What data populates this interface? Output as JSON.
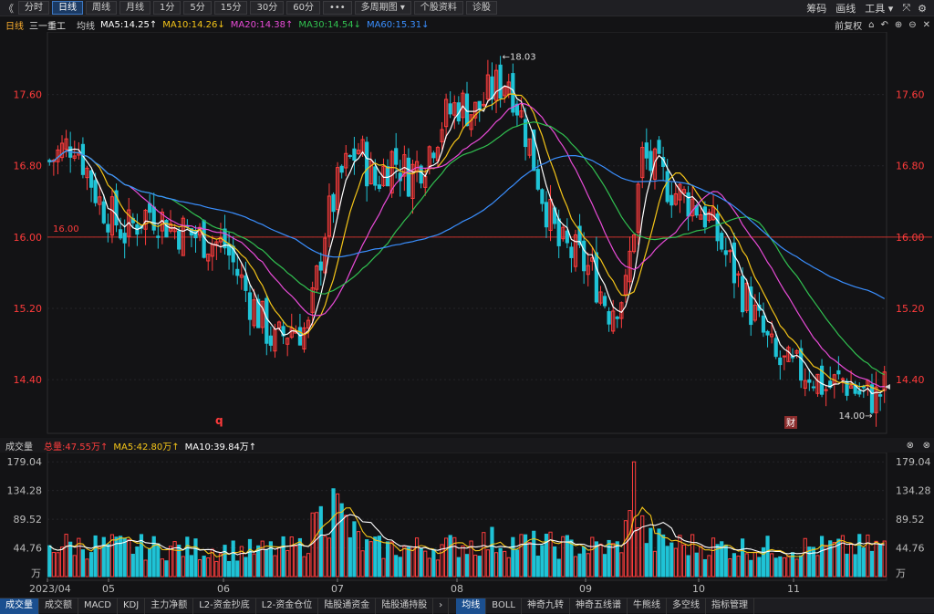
{
  "toolbar": {
    "back": "《",
    "buttons": [
      "分时",
      "日线",
      "周线",
      "月线",
      "1分",
      "5分",
      "15分",
      "30分",
      "60分",
      "•••",
      "多周期图 ▾",
      "个股资料",
      "诊股"
    ],
    "active_index": 1,
    "right_links": [
      "筹码",
      "画线",
      "工具 ▾"
    ],
    "icons": [
      "⤧",
      "⚙"
    ]
  },
  "ma_header": {
    "period": "日线",
    "stock": "三一重工",
    "avg_label": "均线",
    "ma5": "MA5:14.25↑",
    "ma10": "MA10:14.26↓",
    "ma20": "MA20:14.38↑",
    "ma30": "MA30:14.54↓",
    "ma60": "MA60:15.31↓",
    "right_label": "前复权",
    "right_icons": [
      "⌂",
      "↶",
      "⊕",
      "⊖",
      "✕"
    ]
  },
  "colors": {
    "up": "#ff3d3d",
    "down": "#1fc3d6",
    "ma5": "#ffffff",
    "ma10": "#f5c518",
    "ma20": "#e94bd8",
    "ma30": "#31c050",
    "ma60": "#3a8fff",
    "axis_red": "#ff3b3b",
    "vol_label": "#bbbbbb"
  },
  "volume_header": {
    "title": "成交量",
    "total": "总量:47.55万↑",
    "ma5": "MA5:42.80万↑",
    "ma10": "MA10:39.84万↑",
    "icons": [
      "⊗",
      "⊗"
    ]
  },
  "price_axis": {
    "ticks": [
      "17.60",
      "16.80",
      "16.00",
      "15.20",
      "14.40"
    ]
  },
  "volume_axis": {
    "ticks": [
      "179.04",
      "134.28",
      "89.52",
      "44.76"
    ],
    "unit": "万"
  },
  "x_axis": {
    "labels": [
      "2023/04",
      "05",
      "06",
      "07",
      "08",
      "09",
      "10",
      "11"
    ]
  },
  "annotations": {
    "high": "←18.03",
    "low": "14.00→",
    "hline": "16.00",
    "marker_q": "q",
    "marker_cai": "财"
  },
  "bottom_tabs": {
    "left": [
      "成交量",
      "成交额",
      "MACD",
      "KDJ",
      "主力净额",
      "L2-资金抄底",
      "L2-资金仓位",
      "陆股通资金",
      "陆股通持股"
    ],
    "left_active": 0,
    "arrow": "›",
    "right": [
      "均线",
      "BOLL",
      "神奇九转",
      "神奇五线谱",
      "牛熊线",
      "多空线",
      "指标管理"
    ],
    "right_active": 0
  },
  "chart_data": {
    "type": "candlestick",
    "y_range": [
      13.9,
      18.2
    ],
    "hline_value": 16.0,
    "ohlc_knots": [
      [
        0,
        16.85
      ],
      [
        6,
        17.1
      ],
      [
        12,
        16.4
      ],
      [
        18,
        16.05
      ],
      [
        24,
        16.3
      ],
      [
        30,
        16.1
      ],
      [
        36,
        16.0
      ],
      [
        42,
        15.9
      ],
      [
        48,
        15.3
      ],
      [
        54,
        14.8
      ],
      [
        58,
        15.0
      ],
      [
        62,
        14.95
      ],
      [
        66,
        16.1
      ],
      [
        70,
        16.7
      ],
      [
        74,
        17.0
      ],
      [
        78,
        16.6
      ],
      [
        82,
        16.9
      ],
      [
        86,
        16.7
      ],
      [
        90,
        16.9
      ],
      [
        94,
        17.3
      ],
      [
        98,
        17.5
      ],
      [
        102,
        17.4
      ],
      [
        106,
        17.65
      ],
      [
        110,
        17.8
      ],
      [
        114,
        17.2
      ],
      [
        118,
        16.5
      ],
      [
        122,
        15.9
      ],
      [
        126,
        15.8
      ],
      [
        130,
        15.6
      ],
      [
        134,
        15.2
      ],
      [
        138,
        15.4
      ],
      [
        142,
        16.9
      ],
      [
        146,
        16.7
      ],
      [
        150,
        16.5
      ],
      [
        154,
        16.4
      ],
      [
        158,
        16.2
      ],
      [
        162,
        15.8
      ],
      [
        166,
        15.4
      ],
      [
        170,
        15.0
      ],
      [
        174,
        14.6
      ],
      [
        178,
        14.5
      ],
      [
        182,
        14.5
      ],
      [
        186,
        14.3
      ],
      [
        190,
        14.4
      ],
      [
        194,
        14.25
      ],
      [
        198,
        14.2
      ],
      [
        200,
        14.3
      ]
    ],
    "volume_knots": [
      [
        0,
        50
      ],
      [
        10,
        48
      ],
      [
        20,
        46
      ],
      [
        30,
        44
      ],
      [
        40,
        42
      ],
      [
        50,
        40
      ],
      [
        60,
        45
      ],
      [
        64,
        80
      ],
      [
        68,
        115
      ],
      [
        72,
        70
      ],
      [
        76,
        45
      ],
      [
        86,
        44
      ],
      [
        96,
        47
      ],
      [
        106,
        55
      ],
      [
        116,
        50
      ],
      [
        126,
        46
      ],
      [
        136,
        45
      ],
      [
        140,
        95
      ],
      [
        144,
        55
      ],
      [
        150,
        50
      ],
      [
        160,
        46
      ],
      [
        170,
        44
      ],
      [
        180,
        45
      ],
      [
        190,
        45
      ],
      [
        200,
        47
      ]
    ],
    "annotated_high": 18.03,
    "annotated_low": 14.0
  }
}
